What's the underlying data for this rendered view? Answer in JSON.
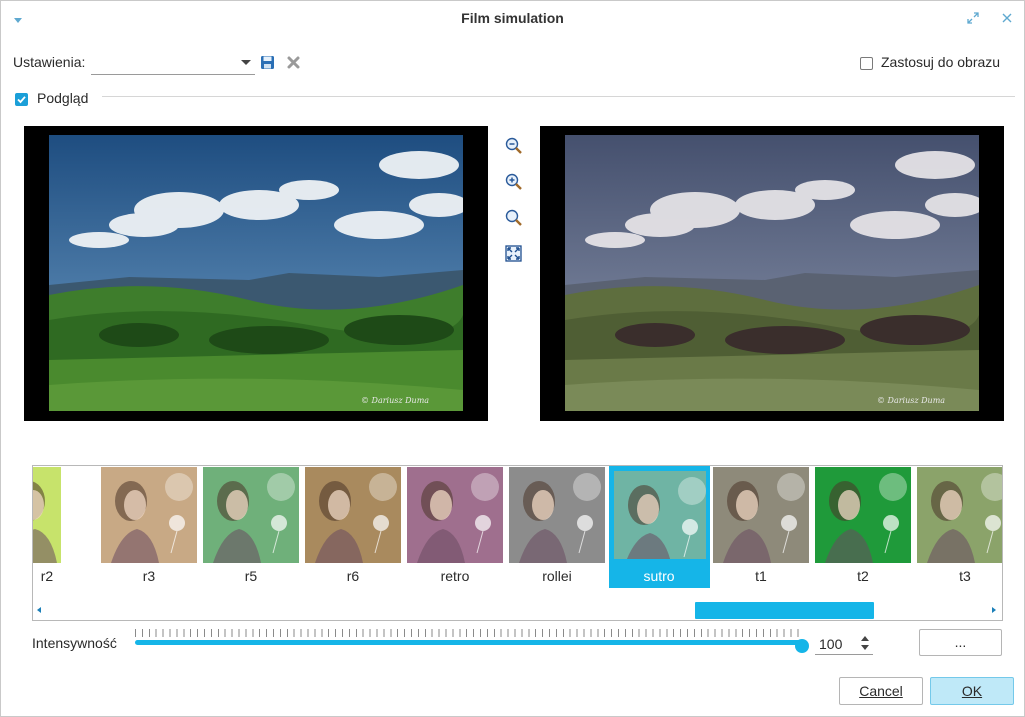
{
  "window": {
    "title": "Film simulation",
    "icons": {
      "menu": "chevron-down-icon",
      "maximize": "maximize-icon",
      "close": "close-icon"
    }
  },
  "settings": {
    "label": "Ustawienia:",
    "value": "",
    "save_icon": "save-icon",
    "delete_icon": "delete-icon"
  },
  "apply": {
    "label": "Zastosuj do obrazu",
    "checked": false
  },
  "preview": {
    "label": "Podgląd",
    "checked": true
  },
  "zoom_tools": [
    "zoom-out-icon",
    "zoom-in-icon",
    "zoom-100-icon",
    "fit-to-window-icon"
  ],
  "filmstrip": {
    "items": [
      {
        "name": "r2",
        "tint": "#c7e36b",
        "selected": false
      },
      {
        "name": "r3",
        "tint": "#c8a985",
        "selected": false
      },
      {
        "name": "r5",
        "tint": "#6fb07a",
        "selected": false
      },
      {
        "name": "r6",
        "tint": "#a98a5e",
        "selected": false
      },
      {
        "name": "retro",
        "tint": "#9f6f8e",
        "selected": false
      },
      {
        "name": "rollei",
        "tint": "#8c8c8c",
        "selected": false
      },
      {
        "name": "sutro",
        "tint": "#6fb4a4",
        "selected": true
      },
      {
        "name": "t1",
        "tint": "#8e8a7a",
        "selected": false
      },
      {
        "name": "t2",
        "tint": "#1f9a3a",
        "selected": false
      },
      {
        "name": "t3",
        "tint": "#8ba36a",
        "selected": false
      }
    ],
    "scroll_position": 0.68
  },
  "intensity": {
    "label": "Intensywność",
    "value": "100",
    "fraction": 1.0
  },
  "more_button": "...",
  "buttons": {
    "cancel": "Cancel",
    "ok": "OK"
  },
  "colors": {
    "accent": "#15b5e8",
    "ok_bg": "#bfe9f8"
  }
}
